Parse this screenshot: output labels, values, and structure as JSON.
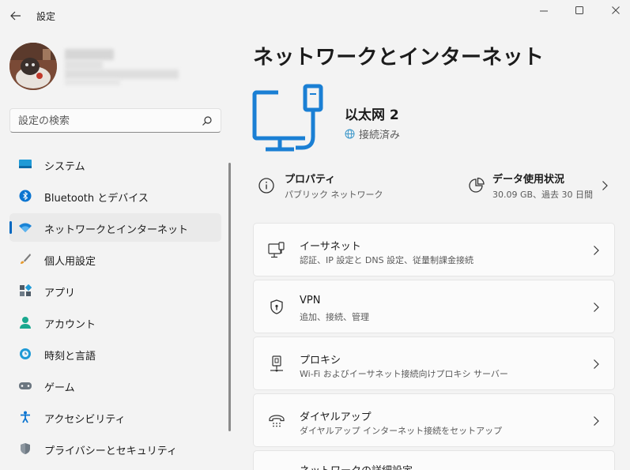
{
  "window": {
    "title": "設定"
  },
  "search": {
    "placeholder": "設定の検索"
  },
  "sidebar": {
    "items": [
      {
        "label": "システム"
      },
      {
        "label": "Bluetooth とデバイス"
      },
      {
        "label": "ネットワークとインターネット"
      },
      {
        "label": "個人用設定"
      },
      {
        "label": "アプリ"
      },
      {
        "label": "アカウント"
      },
      {
        "label": "時刻と言語"
      },
      {
        "label": "ゲーム"
      },
      {
        "label": "アクセシビリティ"
      },
      {
        "label": "プライバシーとセキュリティ"
      }
    ],
    "active_index": 2
  },
  "main": {
    "title": "ネットワークとインターネット",
    "adapter": {
      "name": "以太网 2",
      "status": "接続済み"
    },
    "properties": {
      "title": "プロパティ",
      "subtitle": "パブリック ネットワーク"
    },
    "data_usage": {
      "title": "データ使用状況",
      "subtitle": "30.09 GB、過去 30 日間"
    },
    "cards": [
      {
        "title": "イーサネット",
        "subtitle": "認証、IP 設定と DNS 設定、従量制課金接続",
        "icon": "ethernet-icon"
      },
      {
        "title": "VPN",
        "subtitle": "追加、接続、管理",
        "icon": "vpn-shield-icon"
      },
      {
        "title": "プロキシ",
        "subtitle": "Wi-Fi およびイーサネット接続向けプロキシ サーバー",
        "icon": "proxy-icon"
      },
      {
        "title": "ダイヤルアップ",
        "subtitle": "ダイヤルアップ インターネット接続をセットアップ",
        "icon": "dialup-icon"
      },
      {
        "title": "ネットワークの詳細設定"
      }
    ]
  },
  "colors": {
    "accent": "#0067c0",
    "background": "#f3f3f3",
    "card": "#fbfbfb",
    "hero_icon": "#1a7fd4",
    "status_globe": "#3a96c9"
  }
}
